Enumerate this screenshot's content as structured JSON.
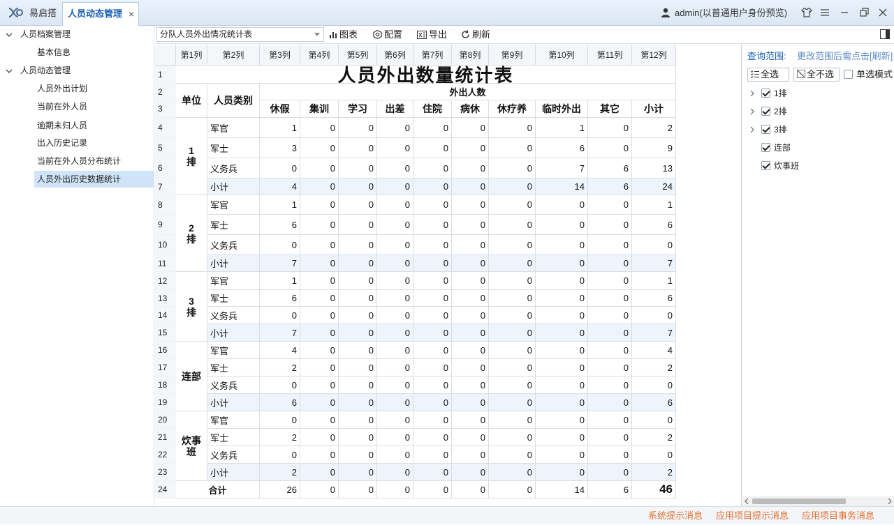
{
  "app": {
    "home_tab": "易启搭",
    "active_tab": "人员动态管理",
    "close_glyph": "×",
    "user": "admin(以普通用户身份预览)"
  },
  "sidebar": {
    "groups": [
      {
        "label": "人员档案管理",
        "items": [
          "基本信息"
        ]
      },
      {
        "label": "人员动态管理",
        "items": [
          "人员外出计划",
          "当前在外人员",
          "逾期未归人员",
          "出入历史记录",
          "当前在外人员分布统计",
          "人员外出历史数据统计"
        ]
      }
    ],
    "selected": "人员外出历史数据统计"
  },
  "toolbar": {
    "report_name": "分队人员外出情况统计表",
    "chart_label": "图表",
    "config_label": "配置",
    "export_label": "导出",
    "refresh_label": "刷新"
  },
  "grid": {
    "column_headers": [
      "第1列",
      "第2列",
      "第3列",
      "第4列",
      "第5列",
      "第6列",
      "第7列",
      "第8列",
      "第9列",
      "第10列",
      "第11列",
      "第12列"
    ],
    "row_numbers": [
      "1",
      "2",
      "3",
      "4",
      "5",
      "6",
      "7",
      "8",
      "9",
      "10",
      "11",
      "12",
      "13",
      "14",
      "15",
      "16",
      "17",
      "18",
      "19",
      "20",
      "21",
      "22",
      "23",
      "24"
    ],
    "title": "人员外出数量统计表",
    "hdr_unit": "单位",
    "hdr_type": "人员类别",
    "hdr_out": "外出人数",
    "categories": [
      "休假",
      "集训",
      "学习",
      "出差",
      "住院",
      "病休",
      "休疗养",
      "临时外出",
      "其它",
      "小计"
    ],
    "units": [
      {
        "name": "1\n排",
        "rows": [
          {
            "type": "军官",
            "values": [
              "1",
              "0",
              "0",
              "0",
              "0",
              "0",
              "0",
              "1",
              "0",
              "2"
            ]
          },
          {
            "type": "军士",
            "values": [
              "3",
              "0",
              "0",
              "0",
              "0",
              "0",
              "0",
              "6",
              "0",
              "9"
            ]
          },
          {
            "type": "义务兵",
            "values": [
              "0",
              "0",
              "0",
              "0",
              "0",
              "0",
              "0",
              "7",
              "6",
              "13"
            ]
          },
          {
            "type": "小计",
            "values": [
              "4",
              "0",
              "0",
              "0",
              "0",
              "0",
              "0",
              "14",
              "6",
              "24"
            ]
          }
        ]
      },
      {
        "name": "2\n排",
        "rows": [
          {
            "type": "军官",
            "values": [
              "1",
              "0",
              "0",
              "0",
              "0",
              "0",
              "0",
              "0",
              "0",
              "1"
            ]
          },
          {
            "type": "军士",
            "values": [
              "6",
              "0",
              "0",
              "0",
              "0",
              "0",
              "0",
              "0",
              "0",
              "6"
            ]
          },
          {
            "type": "义务兵",
            "values": [
              "0",
              "0",
              "0",
              "0",
              "0",
              "0",
              "0",
              "0",
              "0",
              "0"
            ]
          },
          {
            "type": "小计",
            "values": [
              "7",
              "0",
              "0",
              "0",
              "0",
              "0",
              "0",
              "0",
              "0",
              "7"
            ]
          }
        ]
      },
      {
        "name": "3\n排",
        "rows": [
          {
            "type": "军官",
            "values": [
              "1",
              "0",
              "0",
              "0",
              "0",
              "0",
              "0",
              "0",
              "0",
              "1"
            ]
          },
          {
            "type": "军士",
            "values": [
              "6",
              "0",
              "0",
              "0",
              "0",
              "0",
              "0",
              "0",
              "0",
              "6"
            ]
          },
          {
            "type": "义务兵",
            "values": [
              "0",
              "0",
              "0",
              "0",
              "0",
              "0",
              "0",
              "0",
              "0",
              "0"
            ]
          },
          {
            "type": "小计",
            "values": [
              "7",
              "0",
              "0",
              "0",
              "0",
              "0",
              "0",
              "0",
              "0",
              "7"
            ]
          }
        ]
      },
      {
        "name": "连部",
        "rows": [
          {
            "type": "军官",
            "values": [
              "4",
              "0",
              "0",
              "0",
              "0",
              "0",
              "0",
              "0",
              "0",
              "4"
            ]
          },
          {
            "type": "军士",
            "values": [
              "2",
              "0",
              "0",
              "0",
              "0",
              "0",
              "0",
              "0",
              "0",
              "2"
            ]
          },
          {
            "type": "义务兵",
            "values": [
              "0",
              "0",
              "0",
              "0",
              "0",
              "0",
              "0",
              "0",
              "0",
              "0"
            ]
          },
          {
            "type": "小计",
            "values": [
              "6",
              "0",
              "0",
              "0",
              "0",
              "0",
              "0",
              "0",
              "0",
              "6"
            ]
          }
        ]
      },
      {
        "name": "炊事\n班",
        "rows": [
          {
            "type": "军官",
            "values": [
              "0",
              "0",
              "0",
              "0",
              "0",
              "0",
              "0",
              "0",
              "0",
              "0"
            ]
          },
          {
            "type": "军士",
            "values": [
              "2",
              "0",
              "0",
              "0",
              "0",
              "0",
              "0",
              "0",
              "0",
              "2"
            ]
          },
          {
            "type": "义务兵",
            "values": [
              "0",
              "0",
              "0",
              "0",
              "0",
              "0",
              "0",
              "0",
              "0",
              "0"
            ]
          },
          {
            "type": "小计",
            "values": [
              "2",
              "0",
              "0",
              "0",
              "0",
              "0",
              "0",
              "0",
              "0",
              "2"
            ]
          }
        ]
      }
    ],
    "total": {
      "label": "合计",
      "values": [
        "26",
        "0",
        "0",
        "0",
        "0",
        "0",
        "0",
        "14",
        "6",
        "46"
      ]
    }
  },
  "panel": {
    "scope_label": "查询范围:",
    "hint": "更改范围后需点击[刷新]",
    "select_all": "全选",
    "select_none": "全不选",
    "single_mode": "单选模式",
    "tree": [
      {
        "label": "1排",
        "expandable": true,
        "checked": true
      },
      {
        "label": "2排",
        "expandable": true,
        "checked": true
      },
      {
        "label": "3排",
        "expandable": true,
        "checked": true
      },
      {
        "label": "连部",
        "expandable": false,
        "checked": true
      },
      {
        "label": "炊事班",
        "expandable": false,
        "checked": true
      }
    ]
  },
  "footer": {
    "msg1": "系统提示消息",
    "msg2": "应用项目提示消息",
    "msg3": "应用项目事务消息"
  },
  "colors": {
    "accent": "#1a5fb4",
    "footer_msg": "#e0702e",
    "selected_bg": "#cfe4f7",
    "subtotal_bg": "#eef4fb"
  }
}
